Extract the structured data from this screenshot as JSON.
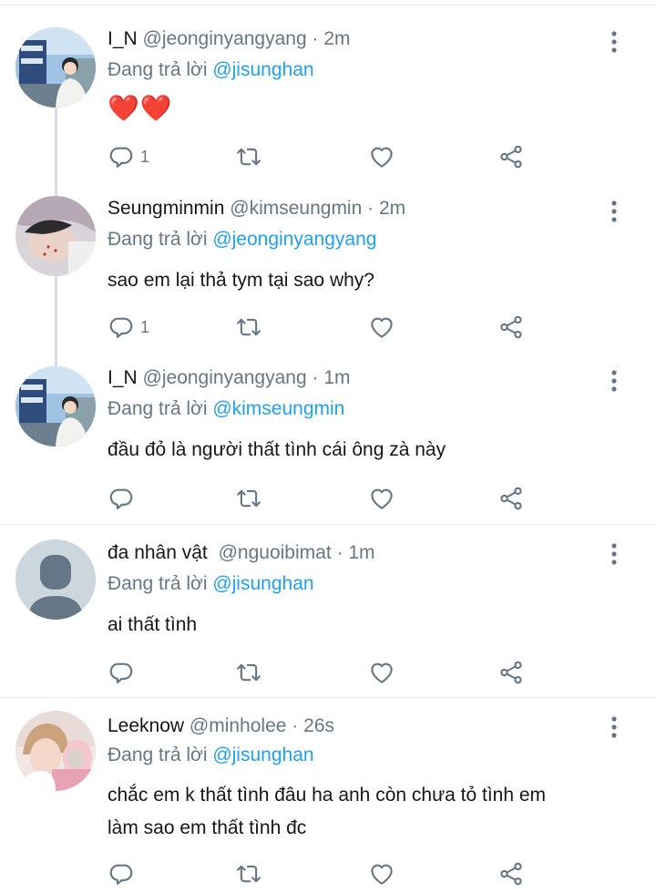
{
  "colors": {
    "accent": "#1da1f2",
    "secondary_text": "#657786",
    "heart": "#e0245e",
    "divider": "#e6ecf0"
  },
  "tweets": [
    {
      "name": "I_N",
      "handle": "@jeonginyangyang",
      "dot": "·",
      "time": "2m",
      "replying_prefix": "Đang trả lời",
      "replying_to": "@jisunghan",
      "text": "❤️❤️",
      "reply_count": "1",
      "avatar_icon": "profile-photo"
    },
    {
      "name": "Seungminmin",
      "handle": "@kimseungmin",
      "dot": "·",
      "time": "2m",
      "replying_prefix": "Đang trả lời",
      "replying_to": "@jeonginyangyang",
      "text": "sao em lại thả tym tại sao why?",
      "reply_count": "1",
      "avatar_icon": "profile-photo"
    },
    {
      "name": "I_N",
      "handle": "@jeonginyangyang",
      "dot": "·",
      "time": "1m",
      "replying_prefix": "Đang trả lời",
      "replying_to": "@kimseungmin",
      "text": "đầu đỏ là người thất tình cái ông zà này",
      "reply_count": "",
      "avatar_icon": "profile-photo"
    },
    {
      "name": "đa nhân vật",
      "handle": "@nguoibimat",
      "dot": "·",
      "time": "1m",
      "replying_prefix": "Đang trả lời",
      "replying_to": "@jisunghan",
      "text": "ai thất tình",
      "reply_count": "",
      "avatar_icon": "default-avatar"
    },
    {
      "name": "Leeknow",
      "handle": "@minholee",
      "dot": "·",
      "time": "26s",
      "replying_prefix": "Đang trả lời",
      "replying_to": "@jisunghan",
      "text_line1": "chắc em k thất tình đâu ha anh còn chưa tỏ tình em",
      "text_line2": "làm sao em thất tình đc",
      "reply_count": "",
      "avatar_icon": "profile-photo"
    }
  ]
}
